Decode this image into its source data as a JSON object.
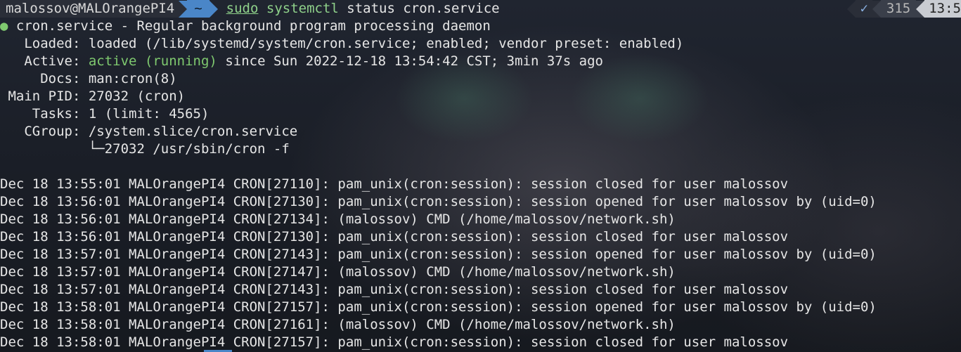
{
  "prompt": {
    "user_host": "malossov@MALOrangePI4",
    "dir": "~",
    "cmd_sudo": "sudo",
    "cmd_prog": "systemctl",
    "cmd_args": " status cron.service"
  },
  "right_prompt": {
    "check": "✓",
    "count": "315",
    "time": "13:5"
  },
  "status": {
    "dot": "●",
    "title": " cron.service - Regular background program processing daemon",
    "loaded": "   Loaded: loaded (/lib/systemd/system/cron.service; enabled; vendor preset: enabled)",
    "active_label": "   Active: ",
    "active_state": "active (running)",
    "active_rest": " since Sun 2022-12-18 13:54:42 CST; 3min 37s ago",
    "docs": "     Docs: man:cron(8)",
    "main_pid": " Main PID: 27032 (cron)",
    "tasks": "    Tasks: 1 (limit: 4565)",
    "cgroup": "   CGroup: /system.slice/cron.service",
    "cgroup_child": "           └─27032 /usr/sbin/cron -f"
  },
  "log_lines": [
    "Dec 18 13:55:01 MALOrangePI4 CRON[27110]: pam_unix(cron:session): session closed for user malossov",
    "Dec 18 13:56:01 MALOrangePI4 CRON[27130]: pam_unix(cron:session): session opened for user malossov by (uid=0)",
    "Dec 18 13:56:01 MALOrangePI4 CRON[27134]: (malossov) CMD (/home/malossov/network.sh)",
    "Dec 18 13:56:01 MALOrangePI4 CRON[27130]: pam_unix(cron:session): session closed for user malossov",
    "Dec 18 13:57:01 MALOrangePI4 CRON[27143]: pam_unix(cron:session): session opened for user malossov by (uid=0)",
    "Dec 18 13:57:01 MALOrangePI4 CRON[27147]: (malossov) CMD (/home/malossov/network.sh)",
    "Dec 18 13:57:01 MALOrangePI4 CRON[27143]: pam_unix(cron:session): session closed for user malossov",
    "Dec 18 13:58:01 MALOrangePI4 CRON[27157]: pam_unix(cron:session): session opened for user malossov by (uid=0)",
    "Dec 18 13:58:01 MALOrangePI4 CRON[27161]: (malossov) CMD (/home/malossov/network.sh)",
    "Dec 18 13:58:01 MALOrangePI4 CRON[27157]: pam_unix(cron:session): session closed for user malossov"
  ],
  "colors": {
    "dir_segment": "#4a86c8",
    "active_green": "#7fc96f",
    "command_green": "#8fd18a"
  }
}
